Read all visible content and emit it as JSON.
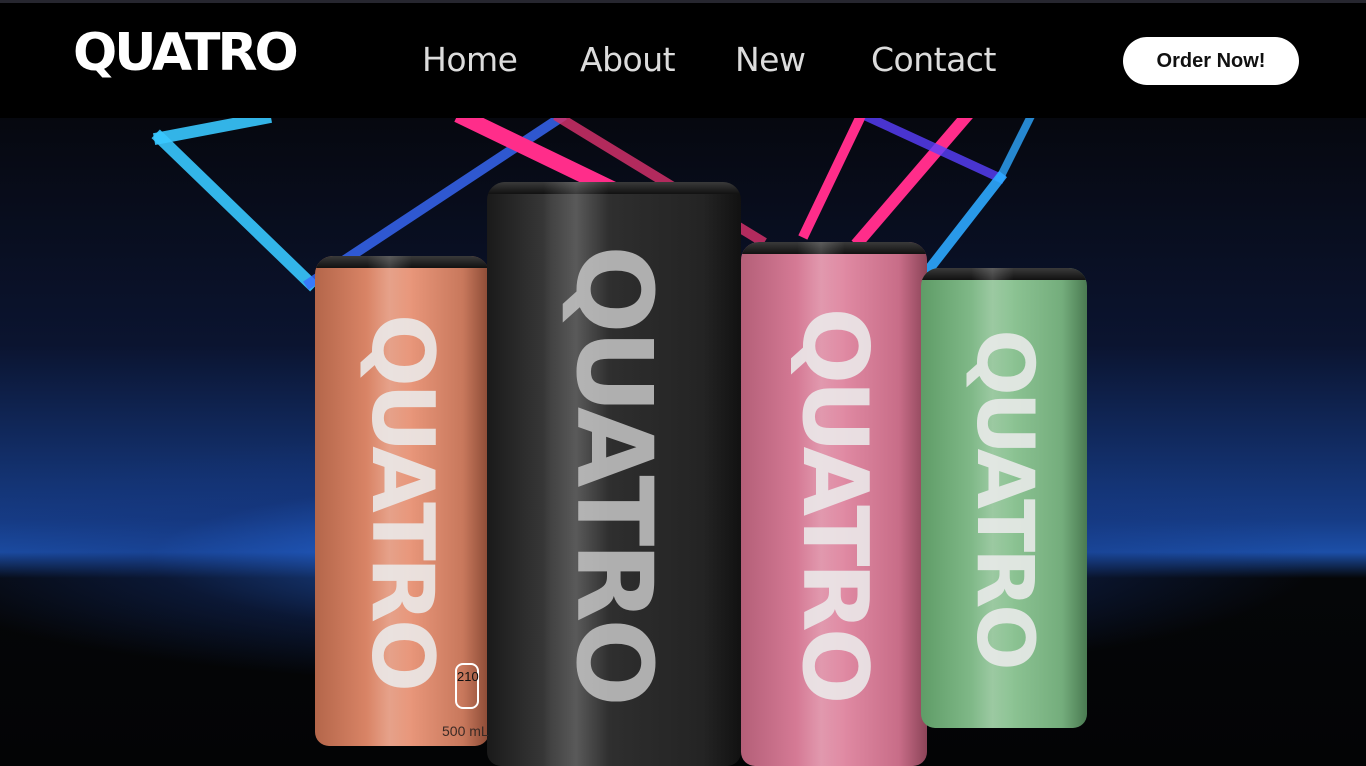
{
  "brand": {
    "logo_text": "QUATRO"
  },
  "nav": {
    "items": [
      {
        "label": "Home"
      },
      {
        "label": "About"
      },
      {
        "label": "New"
      },
      {
        "label": "Contact"
      }
    ]
  },
  "cta": {
    "label": "Order Now!"
  },
  "hero": {
    "cans": [
      {
        "label": "QUATRO",
        "color": "#d98466"
      },
      {
        "label": "QUATRO",
        "color": "#2c2c2c"
      },
      {
        "label": "QUATRO",
        "color": "#d57a95"
      },
      {
        "label": "QUATRO",
        "color": "#7fb887"
      }
    ],
    "calories": "210",
    "volume": "500 mL"
  },
  "colors": {
    "header_bg": "#000000",
    "button_bg": "#ffffff",
    "neon_pink": "#ff2d8a",
    "neon_blue": "#2ea8ff"
  }
}
